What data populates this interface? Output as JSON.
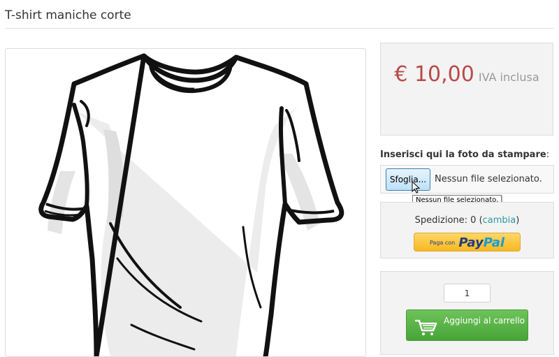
{
  "page": {
    "title": "T-shirt maniche corte"
  },
  "product_image": {
    "icon": "tshirt-illustration"
  },
  "price": {
    "value": "€ 10,00",
    "tax_note": "IVA inclusa",
    "color": "#b94a48"
  },
  "upload": {
    "label_bold": "Inserisci qui la foto da stampare",
    "label_suffix": ":",
    "browse_label": "Sfoglia...",
    "no_file_text": "Nessun file selezionato.",
    "tooltip": "Nessun file selezionato."
  },
  "shipping": {
    "prefix": "Spedizione: ",
    "value": "0",
    "open_paren": " (",
    "change_link": "cambia",
    "close_paren": ")",
    "link_color": "#2a9aa1"
  },
  "paypal": {
    "small_text": "Paga con",
    "logo_pay": "Pay",
    "logo_pal": "Pal"
  },
  "cart": {
    "quantity": "1",
    "button_label": "Aggiungi al carrello",
    "icon": "cart-icon",
    "color": "#48a437"
  }
}
